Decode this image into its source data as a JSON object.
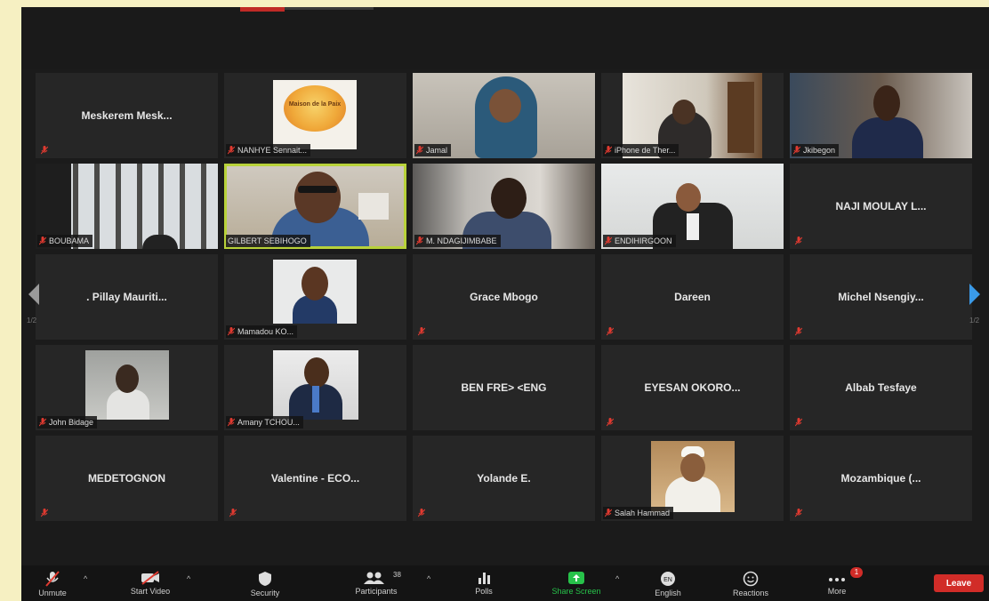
{
  "pagination": {
    "left": "1/2",
    "right": "1/2"
  },
  "tiles": [
    {
      "name": "Meskerem  Mesk...",
      "type": "text"
    },
    {
      "name": "NANHYE Sennait...",
      "type": "logo",
      "logo_text": "Maison de la Paix"
    },
    {
      "name": "Jamal",
      "type": "video"
    },
    {
      "name": "iPhone de Ther...",
      "type": "video"
    },
    {
      "name": "Jkibegon",
      "type": "video"
    },
    {
      "name": "BOUBAMA",
      "type": "video"
    },
    {
      "name": "GILBERT SEBIHOGO",
      "type": "video"
    },
    {
      "name": "M. NDAGIJIMBABE",
      "type": "video"
    },
    {
      "name": "ENDIHIRGOON",
      "type": "video"
    },
    {
      "name": "NAJI  MOULAY  L...",
      "type": "text"
    },
    {
      "name": ".  Pillay  Mauriti...",
      "type": "text"
    },
    {
      "name": "Mamadou KO...",
      "type": "video"
    },
    {
      "name": "Grace Mbogo",
      "type": "text"
    },
    {
      "name": "Dareen",
      "type": "text"
    },
    {
      "name": "Michel  Nsengiy...",
      "type": "text"
    },
    {
      "name": "John Bidage",
      "type": "video"
    },
    {
      "name": "Amany TCHOU...",
      "type": "video"
    },
    {
      "name": "BEN FRE> <ENG",
      "type": "text"
    },
    {
      "name": "EYESAN  OKORO...",
      "type": "text"
    },
    {
      "name": "Albab Tesfaye",
      "type": "text"
    },
    {
      "name": "MEDETOGNON",
      "type": "text"
    },
    {
      "name": "Valentine  -  ECO...",
      "type": "text"
    },
    {
      "name": "Yolande E.",
      "type": "text"
    },
    {
      "name": "Salah Hammad",
      "type": "video"
    },
    {
      "name": "Mozambique  (...",
      "type": "text"
    }
  ],
  "toolbar": {
    "unmute": "Unmute",
    "start_video": "Start Video",
    "security": "Security",
    "participants": "Participants",
    "participants_count": "38",
    "polls": "Polls",
    "share_screen": "Share Screen",
    "english": "English",
    "reactions": "Reactions",
    "more": "More",
    "more_badge": "1",
    "leave": "Leave"
  },
  "colors": {
    "active_speaker": "#b8d23a",
    "leave": "#d12c28",
    "share": "#27c24a",
    "muted_mic": "#e03a30"
  }
}
